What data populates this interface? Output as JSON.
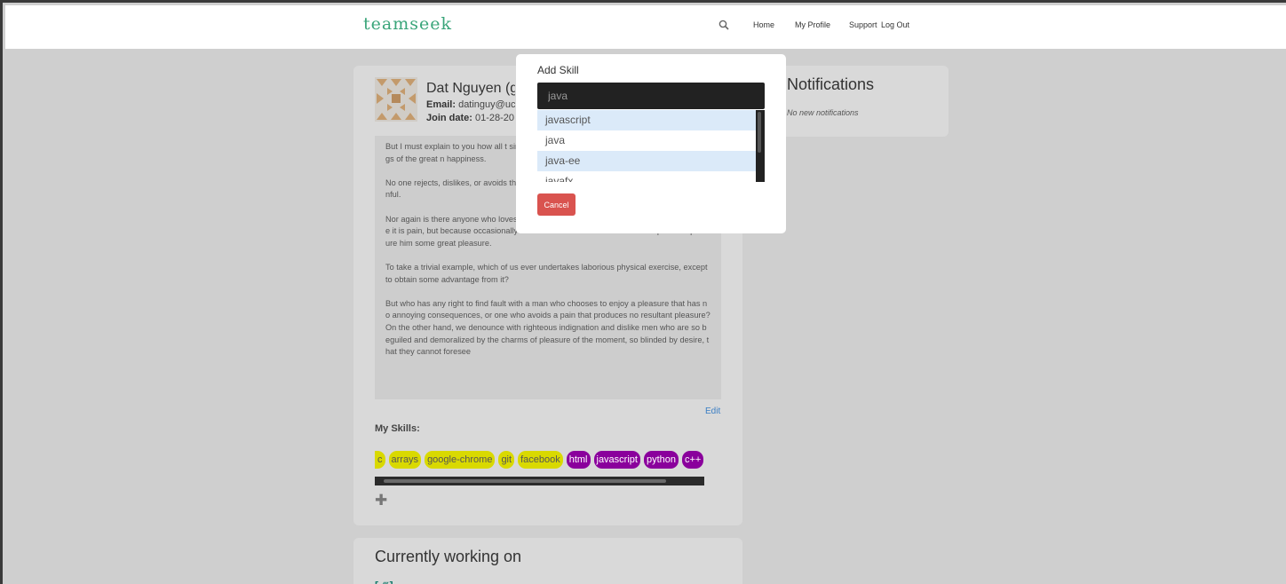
{
  "app": {
    "logo": "teamseek"
  },
  "nav": {
    "home": "Home",
    "profile": "My Profile",
    "support": "Support",
    "logout": "Log Out"
  },
  "profile": {
    "name": "Dat Nguyen (gr",
    "email_label": "Email:",
    "email_value": " datinguy@uc",
    "join_label": "Join date:",
    "join_value": " 01-28-20",
    "bio": [
      "But I must explain to you how all t sing pain was born and I will give y d the actual teachings of the great n happiness.",
      "No one rejects, dislikes, or avoids those who do not know how to pu hat are extremely painful.",
      "Nor again is there anyone who loves or pursues or desires to obtain pain of itself, because it is pain, but because occasionally circumstances occur in which toil and pain can procure him some great pleasure.",
      "To take a trivial example, which of us ever undertakes laborious physical exercise, except to obtain some advantage from it?",
      "But who has any right to find fault with a man who chooses to enjoy a pleasure that has no annoying consequences, or one who avoids a pain that produces no resultant pleasure? On the other hand, we denounce with righteous indignation and dislike men who are so beguiled and demoralized by the charms of pleasure of the moment, so blinded by desire, that they cannot foresee"
    ],
    "edit_label": "Edit",
    "skills_heading": "My Skills:",
    "skills": [
      {
        "label": "c",
        "color": "#d9d900"
      },
      {
        "label": "arrays",
        "color": "#d9d900"
      },
      {
        "label": "google-chrome",
        "color": "#d9d900"
      },
      {
        "label": "git",
        "color": "#d9d900"
      },
      {
        "label": "facebook",
        "color": "#d9d900"
      },
      {
        "label": "html",
        "color": "#8a009c"
      },
      {
        "label": "javascript",
        "color": "#8a009c"
      },
      {
        "label": "python",
        "color": "#8a009c"
      },
      {
        "label": "c++",
        "color": "#8a009c"
      }
    ],
    "add_symbol": "✚"
  },
  "notifications": {
    "title": "Notifications",
    "empty_text": "No new notifications"
  },
  "working": {
    "title": "Currently working on"
  },
  "modal": {
    "title": "Add Skill",
    "input_value": "java",
    "suggestions": [
      "javascript",
      "java",
      "java-ee",
      "javafx"
    ],
    "highlighted": [
      0,
      2
    ],
    "cancel_label": "Cancel"
  }
}
